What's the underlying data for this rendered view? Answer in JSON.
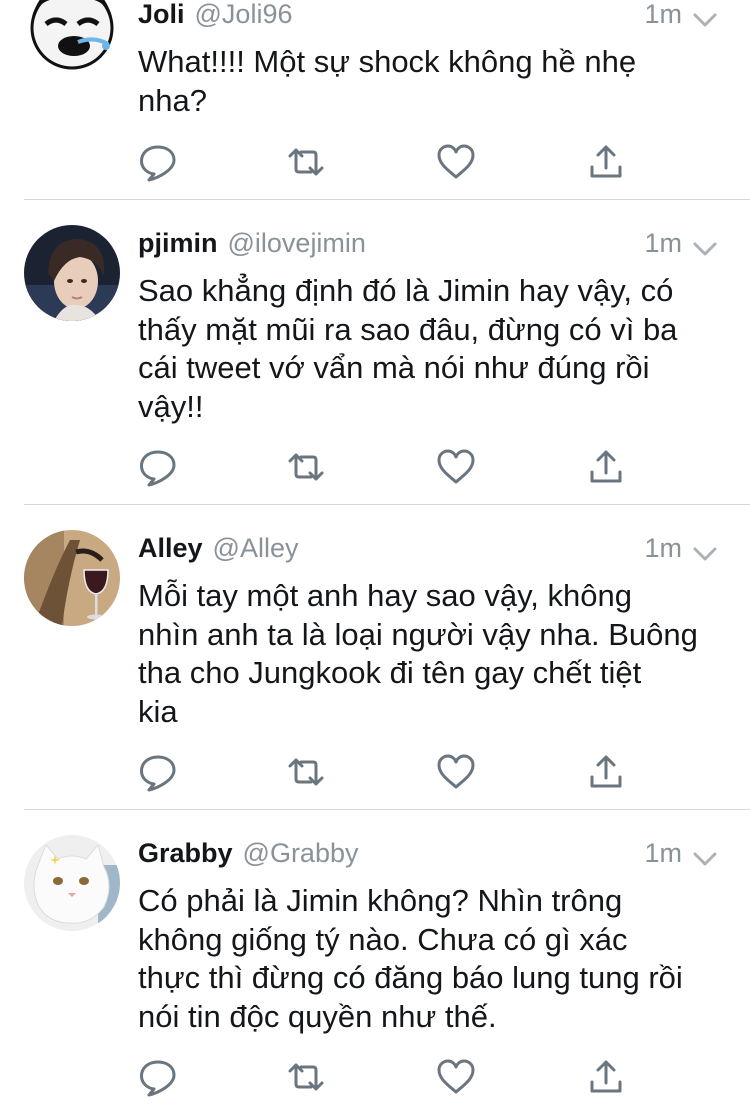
{
  "tweets": [
    {
      "name": "Joli",
      "handle": "@Joli96",
      "time": "1m",
      "avatar_icon": "meme-face-avatar",
      "text_lines": [
        "What!!!! Một sự shock không hề nhẹ",
        "nha?"
      ]
    },
    {
      "name": "pjimin",
      "handle": "@ilovejimin",
      "time": "1m",
      "avatar_icon": "person-photo-avatar",
      "text_lines": [
        "Sao khẳng định đó là Jimin hay vậy, có",
        "thấy mặt mũi ra sao đâu, đừng có vì ba",
        "cái tweet vớ vẩn mà nói như đúng rồi",
        "vậy!!"
      ]
    },
    {
      "name": "Alley",
      "handle": "@Alley",
      "time": "1m",
      "avatar_icon": "wine-glass-photo-avatar",
      "text_lines": [
        "Mỗi tay một anh hay sao vậy, không",
        "nhìn anh ta là loại người vậy nha. Buông",
        "tha cho Jungkook đi tên gay chết tiệt",
        "kia"
      ]
    },
    {
      "name": "Grabby",
      "handle": "@Grabby",
      "time": "1m",
      "avatar_icon": "white-cat-photo-avatar",
      "text_lines": [
        "Có phải là Jimin không? Nhìn trông",
        "không giống tý nào. Chưa có gì xác",
        "thực thì đừng có đăng báo lung tung rồi",
        "nói tin độc quyền như thế."
      ]
    }
  ],
  "icons": {
    "reply": "reply-icon",
    "retweet": "retweet-icon",
    "like": "heart-icon",
    "share": "share-icon",
    "menu": "chevron-down-icon"
  },
  "colors": {
    "text": "#14171a",
    "muted": "#8a9299",
    "icon": "#69757f",
    "divider": "#d4d8db"
  }
}
